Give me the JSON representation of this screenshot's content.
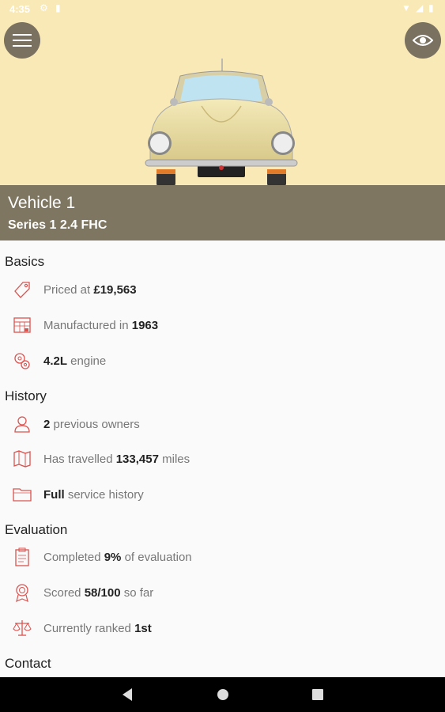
{
  "status": {
    "time": "4:35"
  },
  "vehicle": {
    "name": "Vehicle 1",
    "series": "Series 1 2.4 FHC"
  },
  "sections": {
    "basics": {
      "title": "Basics",
      "price": {
        "pre": "Priced at ",
        "val": "£19,563",
        "post": ""
      },
      "manufactured": {
        "pre": "Manufactured in ",
        "val": "1963",
        "post": ""
      },
      "engine": {
        "pre": "",
        "val": "4.2L",
        "post": " engine"
      }
    },
    "history": {
      "title": "History",
      "owners": {
        "pre": "",
        "val": "2",
        "post": " previous owners"
      },
      "travelled": {
        "pre": "Has travelled ",
        "val": "133,457",
        "post": " miles"
      },
      "service": {
        "pre": "",
        "val": "Full",
        "post": " service history"
      }
    },
    "evaluation": {
      "title": "Evaluation",
      "completed": {
        "pre": "Completed ",
        "val": "9%",
        "post": " of evaluation"
      },
      "scored": {
        "pre": "Scored ",
        "val": "58/100",
        "post": " so far"
      },
      "ranked": {
        "pre": "Currently ranked ",
        "val": "1st",
        "post": ""
      }
    },
    "contact": {
      "title": "Contact"
    }
  },
  "colors": {
    "hero": "#f9e9b6",
    "titlebar": "#7e7660",
    "icon": "#d9534f"
  },
  "icons": [
    "menu-icon",
    "eye-icon",
    "price-tag-icon",
    "calendar-icon",
    "engine-icon",
    "person-icon",
    "map-icon",
    "folder-icon",
    "clipboard-icon",
    "award-icon",
    "scales-icon"
  ]
}
